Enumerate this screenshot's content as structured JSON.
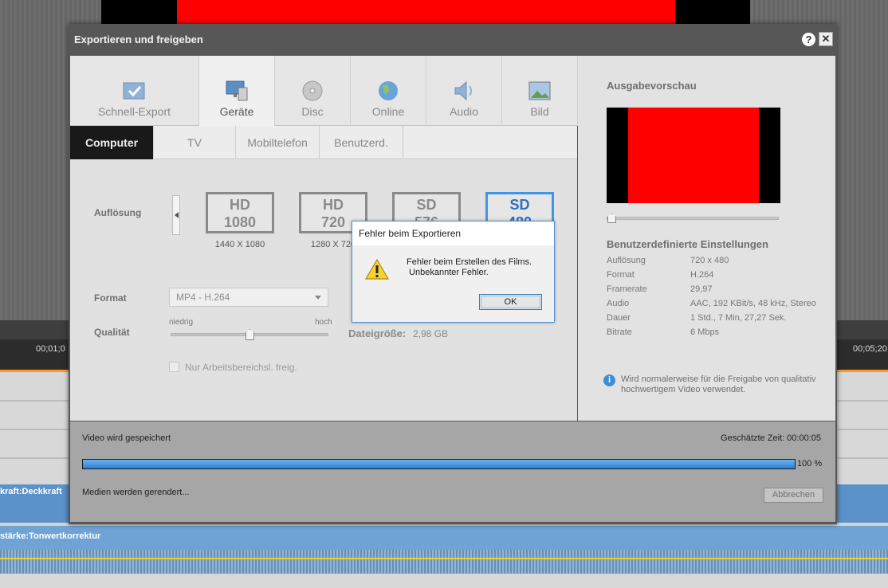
{
  "background": {
    "timecode_left": "00;01;0",
    "timecode_right": "00;05;20",
    "track_label_1": "kraft:Deckkraft",
    "track_label_2": "stärke:Tonwertkorrektur"
  },
  "dialog": {
    "title": "Exportieren und freigeben",
    "help": "?",
    "close": "✕",
    "tabs": [
      {
        "label": "Schnell-Export",
        "icon": "quick-export-icon"
      },
      {
        "label": "Geräte",
        "icon": "devices-icon",
        "active": true
      },
      {
        "label": "Disc",
        "icon": "disc-icon"
      },
      {
        "label": "Online",
        "icon": "globe-icon"
      },
      {
        "label": "Audio",
        "icon": "speaker-icon"
      },
      {
        "label": "Bild",
        "icon": "image-icon"
      }
    ],
    "subtabs": [
      {
        "label": "Computer",
        "active": true
      },
      {
        "label": "TV"
      },
      {
        "label": "Mobiltelefon"
      },
      {
        "label": "Benutzerd."
      }
    ],
    "resolution_label": "Auflösung",
    "resolutions": [
      {
        "line1": "HD",
        "line2": "1080",
        "sub": "1440 X 1080"
      },
      {
        "line1": "HD",
        "line2": "720",
        "sub": "1280 X 720"
      },
      {
        "line1": "SD",
        "line2": "576",
        "sub": ""
      },
      {
        "line1": "SD",
        "line2": "480",
        "sub": "",
        "selected": true
      }
    ],
    "format_label": "Format",
    "format_value": "MP4 - H.264",
    "quality_label": "Qualität",
    "quality_low": "niedrig",
    "quality_high": "hoch",
    "quality_level": 0.5,
    "filesize_label": "Dateigröße:",
    "filesize_value": "2,98 GB",
    "workarea_checkbox": "Nur Arbeitsbereichsl. freig.",
    "preview_title": "Ausgabevorschau",
    "settings_title": "Benutzerdefinierte Einstellungen",
    "settings": [
      {
        "key": "Auflösung",
        "value": "720 x 480"
      },
      {
        "key": "Format",
        "value": "H.264"
      },
      {
        "key": "Framerate",
        "value": "29,97"
      },
      {
        "key": "Audio",
        "value": "AAC, 192 KBit/s, 48 kHz, Stereo"
      },
      {
        "key": "Dauer",
        "value": "1 Std., 7 Min, 27,27 Sek."
      },
      {
        "key": "Bitrate",
        "value": "6 Mbps"
      }
    ],
    "info_text": "Wird normalerweise für die Freigabe von qualitativ hochwertigem Video verwendet.",
    "progress": {
      "status": "Video wird gespeichert",
      "estimated": "Geschätzte Zeit: 00:00:05",
      "percent_text": "100 %",
      "percent": 100,
      "media": "Medien werden gerendert...",
      "cancel": "Abbrechen"
    }
  },
  "error_dialog": {
    "title": "Fehler beim Exportieren",
    "message": "Fehler beim Erstellen des Films.\n Unbekannter Fehler.",
    "ok": "OK",
    "icon": "warning-icon"
  },
  "colors": {
    "accent_blue": "#3e97e6",
    "preview_red": "#ff0000",
    "progress_blue": "#2d7fd1"
  }
}
